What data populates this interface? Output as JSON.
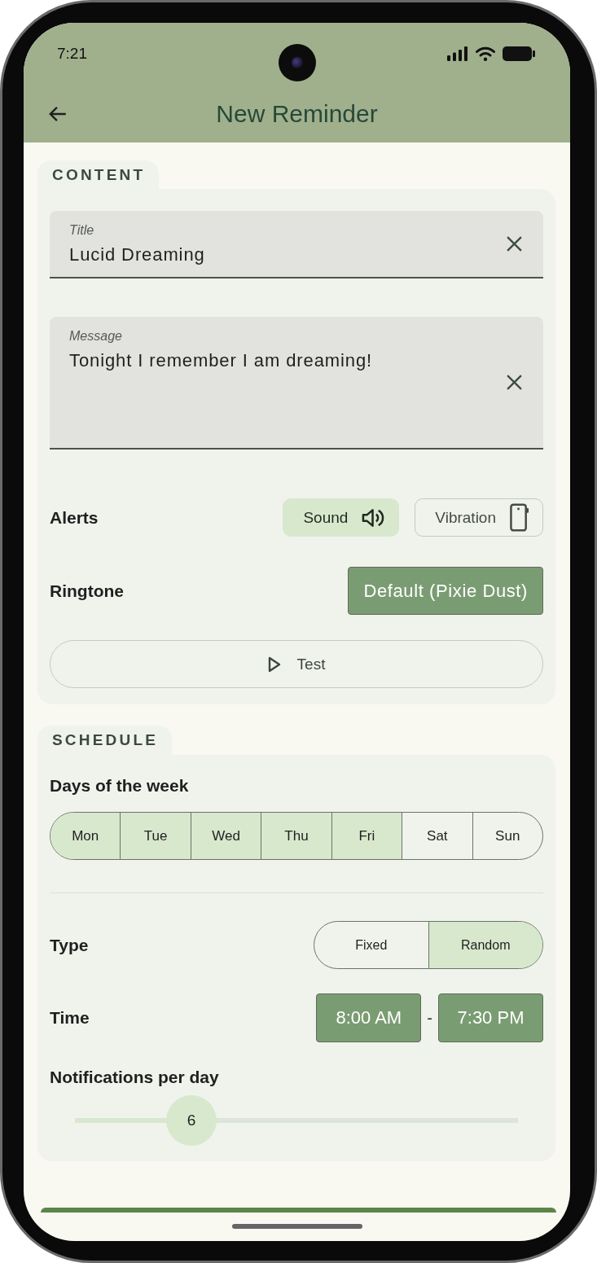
{
  "status_bar": {
    "time": "7:21"
  },
  "app_bar": {
    "title": "New Reminder"
  },
  "content": {
    "heading": "CONTENT",
    "fields": [
      {
        "kind": "line",
        "label": "Title",
        "value": "Lucid Dreaming"
      },
      {
        "kind": "area",
        "label": "Message",
        "value": "Tonight I remember I am dreaming!"
      }
    ],
    "alerts": {
      "label": "Alerts",
      "options": [
        {
          "kind": "sound",
          "label": "Sound",
          "on": true
        },
        {
          "kind": "vibration",
          "label": "Vibration",
          "on": false
        }
      ]
    },
    "ringtone": {
      "label": "Ringtone",
      "value": "Default (Pixie Dust)"
    },
    "test_button": "Test"
  },
  "schedule": {
    "heading": "SCHEDULE",
    "days_label": "Days of the week",
    "days": [
      {
        "label": "Mon",
        "selected": true
      },
      {
        "label": "Tue",
        "selected": true
      },
      {
        "label": "Wed",
        "selected": true
      },
      {
        "label": "Thu",
        "selected": true
      },
      {
        "label": "Fri",
        "selected": true
      },
      {
        "label": "Sat",
        "selected": false
      },
      {
        "label": "Sun",
        "selected": false
      }
    ],
    "type": {
      "label": "Type",
      "options": [
        {
          "label": "Fixed",
          "selected": false
        },
        {
          "label": "Random",
          "selected": true
        }
      ]
    },
    "time": {
      "label": "Time",
      "start": "8:00 AM",
      "separator": "-",
      "end": "7:30 PM"
    },
    "notifications": {
      "label": "Notifications per day",
      "value": "6",
      "level": 0.263
    }
  }
}
